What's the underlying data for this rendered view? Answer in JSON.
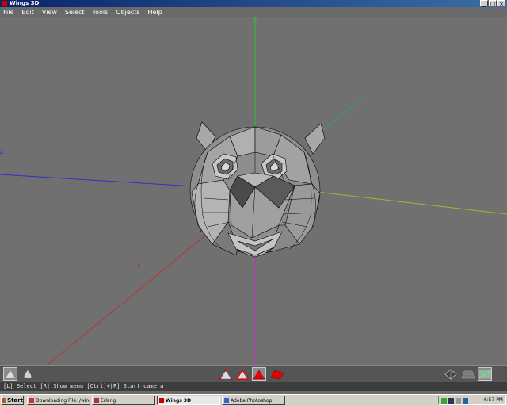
{
  "window": {
    "title": "Wings 3D",
    "controls": [
      "_",
      "□",
      "×"
    ]
  },
  "menubar": {
    "items": [
      "File",
      "Edit",
      "View",
      "Select",
      "Tools",
      "Objects",
      "Help"
    ]
  },
  "viewport": {
    "axis_labels": {
      "y": "y",
      "z": "z",
      "x": "x"
    },
    "colors": {
      "background": "#707070",
      "x_axis": "#c03030",
      "y_axis": "#30c030",
      "z_axis": "#3030d0",
      "mesh_face": "#9a9a9a",
      "mesh_edge": "#000000"
    }
  },
  "toolbar": {
    "left_icons": [
      "smooth-shade-icon",
      "flat-shade-icon"
    ],
    "select_modes": [
      "vertex-select-icon",
      "edge-select-icon",
      "face-select-icon",
      "body-select-icon"
    ],
    "selected_mode": "face",
    "right_icons": [
      "groundplane-icon",
      "perspective-icon",
      "ortho-icon"
    ]
  },
  "statusbar": {
    "text": "[L] Select  [R] Show menu  [Ctrl]+[R] Start camera"
  },
  "taskbar": {
    "start_label": "Start",
    "tasks": [
      {
        "label": "Downloading File: /wings/...",
        "active": false
      },
      {
        "label": "Erlang",
        "active": false
      },
      {
        "label": "Wings 3D",
        "active": true
      },
      {
        "label": "Adobe Photoshop",
        "active": false
      }
    ],
    "clock": "6:57 PM"
  }
}
